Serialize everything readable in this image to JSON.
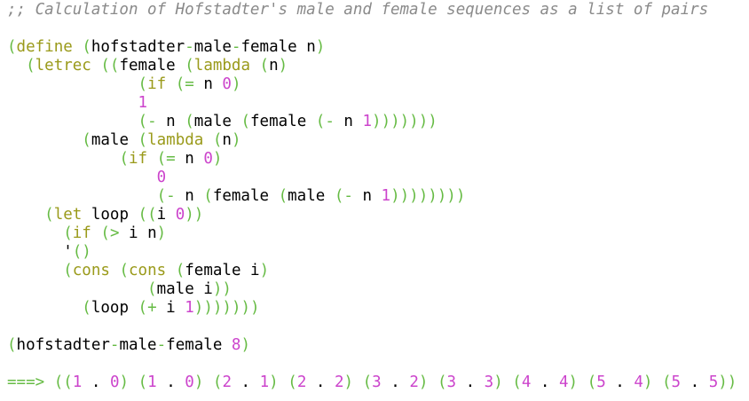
{
  "colors": {
    "background": "#ffffff",
    "plain": "#000000",
    "comment": "#8a8a8a",
    "paren": "#66bb44",
    "keyword": "#9a9a1a",
    "number": "#cc44cc",
    "operator": "#66bb44",
    "prompt": "#66bb44"
  },
  "lines": [
    [
      {
        "t": ";; Calculation of Hofstadter's male and female sequences as a list of pairs",
        "c": "comment"
      }
    ],
    [],
    [
      {
        "t": "(",
        "c": "paren"
      },
      {
        "t": "define",
        "c": "keyword"
      },
      {
        "t": " ",
        "c": "plain"
      },
      {
        "t": "(",
        "c": "paren"
      },
      {
        "t": "hofstadter",
        "c": "plain"
      },
      {
        "t": "-",
        "c": "operator"
      },
      {
        "t": "male",
        "c": "plain"
      },
      {
        "t": "-",
        "c": "operator"
      },
      {
        "t": "female n",
        "c": "plain"
      },
      {
        "t": ")",
        "c": "paren"
      }
    ],
    [
      {
        "t": "  ",
        "c": "plain"
      },
      {
        "t": "(",
        "c": "paren"
      },
      {
        "t": "letrec",
        "c": "keyword"
      },
      {
        "t": " ",
        "c": "plain"
      },
      {
        "t": "((",
        "c": "paren"
      },
      {
        "t": "female",
        "c": "plain"
      },
      {
        "t": " ",
        "c": "plain"
      },
      {
        "t": "(",
        "c": "paren"
      },
      {
        "t": "lambda",
        "c": "keyword"
      },
      {
        "t": " ",
        "c": "plain"
      },
      {
        "t": "(",
        "c": "paren"
      },
      {
        "t": "n",
        "c": "plain"
      },
      {
        "t": ")",
        "c": "paren"
      }
    ],
    [
      {
        "t": "              ",
        "c": "plain"
      },
      {
        "t": "(",
        "c": "paren"
      },
      {
        "t": "if",
        "c": "keyword"
      },
      {
        "t": " ",
        "c": "plain"
      },
      {
        "t": "(",
        "c": "paren"
      },
      {
        "t": "=",
        "c": "operator"
      },
      {
        "t": " n ",
        "c": "plain"
      },
      {
        "t": "0",
        "c": "number"
      },
      {
        "t": ")",
        "c": "paren"
      }
    ],
    [
      {
        "t": "              ",
        "c": "plain"
      },
      {
        "t": "1",
        "c": "number"
      }
    ],
    [
      {
        "t": "              ",
        "c": "plain"
      },
      {
        "t": "(",
        "c": "paren"
      },
      {
        "t": "-",
        "c": "operator"
      },
      {
        "t": " n ",
        "c": "plain"
      },
      {
        "t": "(",
        "c": "paren"
      },
      {
        "t": "male",
        "c": "plain"
      },
      {
        "t": " ",
        "c": "plain"
      },
      {
        "t": "(",
        "c": "paren"
      },
      {
        "t": "female",
        "c": "plain"
      },
      {
        "t": " ",
        "c": "plain"
      },
      {
        "t": "(",
        "c": "paren"
      },
      {
        "t": "-",
        "c": "operator"
      },
      {
        "t": " n ",
        "c": "plain"
      },
      {
        "t": "1",
        "c": "number"
      },
      {
        "t": ")))))))",
        "c": "paren"
      }
    ],
    [
      {
        "t": "        ",
        "c": "plain"
      },
      {
        "t": "(",
        "c": "paren"
      },
      {
        "t": "male",
        "c": "plain"
      },
      {
        "t": " ",
        "c": "plain"
      },
      {
        "t": "(",
        "c": "paren"
      },
      {
        "t": "lambda",
        "c": "keyword"
      },
      {
        "t": " ",
        "c": "plain"
      },
      {
        "t": "(",
        "c": "paren"
      },
      {
        "t": "n",
        "c": "plain"
      },
      {
        "t": ")",
        "c": "paren"
      }
    ],
    [
      {
        "t": "            ",
        "c": "plain"
      },
      {
        "t": "(",
        "c": "paren"
      },
      {
        "t": "if",
        "c": "keyword"
      },
      {
        "t": " ",
        "c": "plain"
      },
      {
        "t": "(",
        "c": "paren"
      },
      {
        "t": "=",
        "c": "operator"
      },
      {
        "t": " n ",
        "c": "plain"
      },
      {
        "t": "0",
        "c": "number"
      },
      {
        "t": ")",
        "c": "paren"
      }
    ],
    [
      {
        "t": "                ",
        "c": "plain"
      },
      {
        "t": "0",
        "c": "number"
      }
    ],
    [
      {
        "t": "                ",
        "c": "plain"
      },
      {
        "t": "(",
        "c": "paren"
      },
      {
        "t": "-",
        "c": "operator"
      },
      {
        "t": " n ",
        "c": "plain"
      },
      {
        "t": "(",
        "c": "paren"
      },
      {
        "t": "female",
        "c": "plain"
      },
      {
        "t": " ",
        "c": "plain"
      },
      {
        "t": "(",
        "c": "paren"
      },
      {
        "t": "male",
        "c": "plain"
      },
      {
        "t": " ",
        "c": "plain"
      },
      {
        "t": "(",
        "c": "paren"
      },
      {
        "t": "-",
        "c": "operator"
      },
      {
        "t": " n ",
        "c": "plain"
      },
      {
        "t": "1",
        "c": "number"
      },
      {
        "t": "))))))))",
        "c": "paren"
      }
    ],
    [
      {
        "t": "    ",
        "c": "plain"
      },
      {
        "t": "(",
        "c": "paren"
      },
      {
        "t": "let",
        "c": "keyword"
      },
      {
        "t": " loop ",
        "c": "plain"
      },
      {
        "t": "((",
        "c": "paren"
      },
      {
        "t": "i ",
        "c": "plain"
      },
      {
        "t": "0",
        "c": "number"
      },
      {
        "t": "))",
        "c": "paren"
      }
    ],
    [
      {
        "t": "      ",
        "c": "plain"
      },
      {
        "t": "(",
        "c": "paren"
      },
      {
        "t": "if",
        "c": "keyword"
      },
      {
        "t": " ",
        "c": "plain"
      },
      {
        "t": "(",
        "c": "paren"
      },
      {
        "t": ">",
        "c": "operator"
      },
      {
        "t": " i n",
        "c": "plain"
      },
      {
        "t": ")",
        "c": "paren"
      }
    ],
    [
      {
        "t": "      ",
        "c": "plain"
      },
      {
        "t": "'",
        "c": "plain"
      },
      {
        "t": "()",
        "c": "paren"
      }
    ],
    [
      {
        "t": "      ",
        "c": "plain"
      },
      {
        "t": "(",
        "c": "paren"
      },
      {
        "t": "cons",
        "c": "keyword"
      },
      {
        "t": " ",
        "c": "plain"
      },
      {
        "t": "(",
        "c": "paren"
      },
      {
        "t": "cons",
        "c": "keyword"
      },
      {
        "t": " ",
        "c": "plain"
      },
      {
        "t": "(",
        "c": "paren"
      },
      {
        "t": "female i",
        "c": "plain"
      },
      {
        "t": ")",
        "c": "paren"
      }
    ],
    [
      {
        "t": "               ",
        "c": "plain"
      },
      {
        "t": "(",
        "c": "paren"
      },
      {
        "t": "male i",
        "c": "plain"
      },
      {
        "t": "))",
        "c": "paren"
      }
    ],
    [
      {
        "t": "        ",
        "c": "plain"
      },
      {
        "t": "(",
        "c": "paren"
      },
      {
        "t": "loop",
        "c": "plain"
      },
      {
        "t": " ",
        "c": "plain"
      },
      {
        "t": "(",
        "c": "paren"
      },
      {
        "t": "+",
        "c": "operator"
      },
      {
        "t": " i ",
        "c": "plain"
      },
      {
        "t": "1",
        "c": "number"
      },
      {
        "t": ")))))))",
        "c": "paren"
      }
    ],
    [],
    [
      {
        "t": "(",
        "c": "paren"
      },
      {
        "t": "hofstadter",
        "c": "plain"
      },
      {
        "t": "-",
        "c": "operator"
      },
      {
        "t": "male",
        "c": "plain"
      },
      {
        "t": "-",
        "c": "operator"
      },
      {
        "t": "female",
        "c": "plain"
      },
      {
        "t": " ",
        "c": "plain"
      },
      {
        "t": "8",
        "c": "number"
      },
      {
        "t": ")",
        "c": "paren"
      }
    ],
    [],
    [
      {
        "t": "===>",
        "c": "prompt"
      },
      {
        "t": " ",
        "c": "plain"
      },
      {
        "t": "((",
        "c": "paren"
      },
      {
        "t": "1",
        "c": "number"
      },
      {
        "t": " . ",
        "c": "plain"
      },
      {
        "t": "0",
        "c": "number"
      },
      {
        "t": ")",
        "c": "paren"
      },
      {
        "t": " ",
        "c": "plain"
      },
      {
        "t": "(",
        "c": "paren"
      },
      {
        "t": "1",
        "c": "number"
      },
      {
        "t": " . ",
        "c": "plain"
      },
      {
        "t": "0",
        "c": "number"
      },
      {
        "t": ")",
        "c": "paren"
      },
      {
        "t": " ",
        "c": "plain"
      },
      {
        "t": "(",
        "c": "paren"
      },
      {
        "t": "2",
        "c": "number"
      },
      {
        "t": " . ",
        "c": "plain"
      },
      {
        "t": "1",
        "c": "number"
      },
      {
        "t": ")",
        "c": "paren"
      },
      {
        "t": " ",
        "c": "plain"
      },
      {
        "t": "(",
        "c": "paren"
      },
      {
        "t": "2",
        "c": "number"
      },
      {
        "t": " . ",
        "c": "plain"
      },
      {
        "t": "2",
        "c": "number"
      },
      {
        "t": ")",
        "c": "paren"
      },
      {
        "t": " ",
        "c": "plain"
      },
      {
        "t": "(",
        "c": "paren"
      },
      {
        "t": "3",
        "c": "number"
      },
      {
        "t": " . ",
        "c": "plain"
      },
      {
        "t": "2",
        "c": "number"
      },
      {
        "t": ")",
        "c": "paren"
      },
      {
        "t": " ",
        "c": "plain"
      },
      {
        "t": "(",
        "c": "paren"
      },
      {
        "t": "3",
        "c": "number"
      },
      {
        "t": " . ",
        "c": "plain"
      },
      {
        "t": "3",
        "c": "number"
      },
      {
        "t": ")",
        "c": "paren"
      },
      {
        "t": " ",
        "c": "plain"
      },
      {
        "t": "(",
        "c": "paren"
      },
      {
        "t": "4",
        "c": "number"
      },
      {
        "t": " . ",
        "c": "plain"
      },
      {
        "t": "4",
        "c": "number"
      },
      {
        "t": ")",
        "c": "paren"
      },
      {
        "t": " ",
        "c": "plain"
      },
      {
        "t": "(",
        "c": "paren"
      },
      {
        "t": "5",
        "c": "number"
      },
      {
        "t": " . ",
        "c": "plain"
      },
      {
        "t": "4",
        "c": "number"
      },
      {
        "t": ")",
        "c": "paren"
      },
      {
        "t": " ",
        "c": "plain"
      },
      {
        "t": "(",
        "c": "paren"
      },
      {
        "t": "5",
        "c": "number"
      },
      {
        "t": " . ",
        "c": "plain"
      },
      {
        "t": "5",
        "c": "number"
      },
      {
        "t": "))",
        "c": "paren"
      }
    ]
  ]
}
